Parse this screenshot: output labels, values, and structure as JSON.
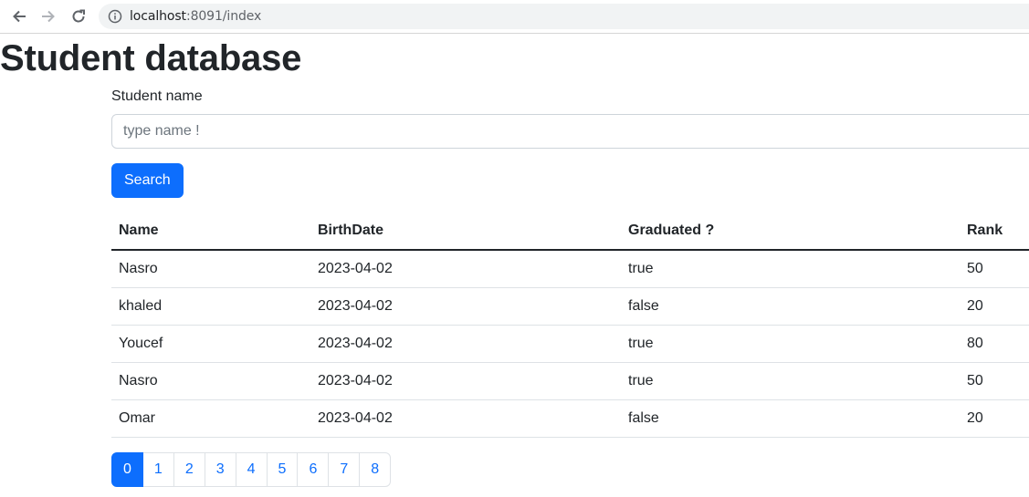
{
  "browser": {
    "url_host": "localhost",
    "url_path": ":8091/index"
  },
  "page": {
    "title": "Student database"
  },
  "search": {
    "label": "Student name",
    "placeholder": "type name !",
    "value": "",
    "button_label": "Search"
  },
  "table": {
    "headers": [
      "Name",
      "BirthDate",
      "Graduated ?",
      "Rank"
    ],
    "rows": [
      [
        "Nasro",
        "2023-04-02",
        "true",
        "50"
      ],
      [
        "khaled",
        "2023-04-02",
        "false",
        "20"
      ],
      [
        "Youcef",
        "2023-04-02",
        "true",
        "80"
      ],
      [
        "Nasro",
        "2023-04-02",
        "true",
        "50"
      ],
      [
        "Omar",
        "2023-04-02",
        "false",
        "20"
      ]
    ]
  },
  "pagination": {
    "pages": [
      "0",
      "1",
      "2",
      "3",
      "4",
      "5",
      "6",
      "7",
      "8"
    ],
    "active": "0"
  },
  "colors": {
    "primary": "#0d6efd",
    "text": "#212529",
    "border": "#dee2e6"
  }
}
